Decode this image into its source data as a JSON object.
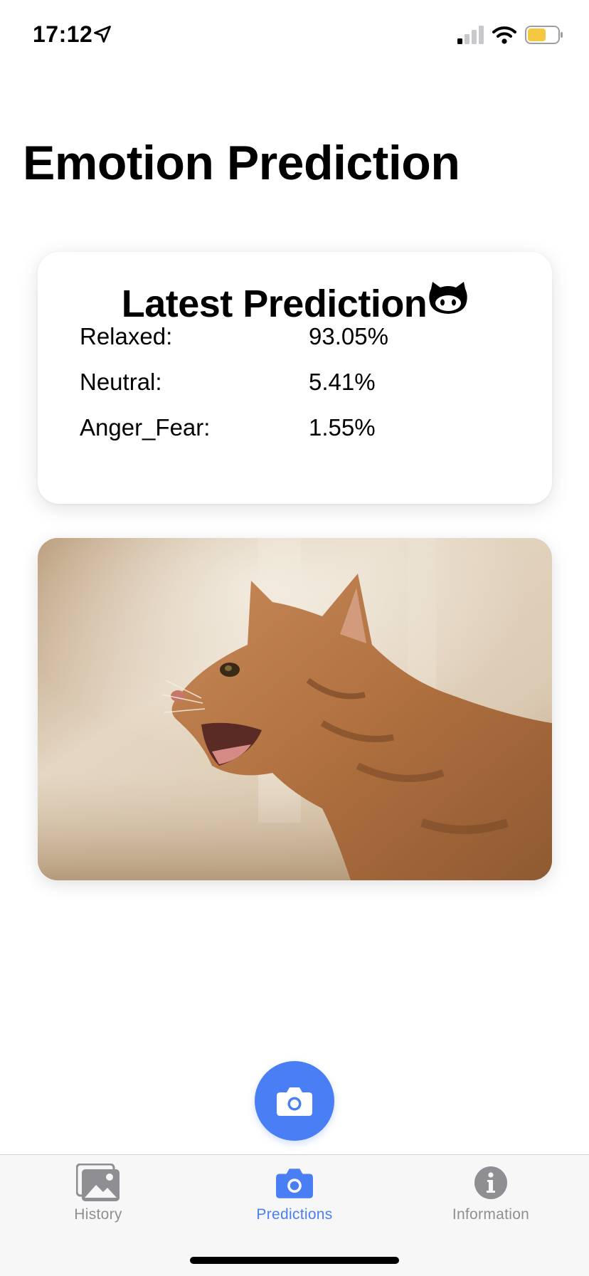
{
  "status_bar": {
    "time": "17:12",
    "icons": [
      "location-arrow-icon",
      "cellular-signal-icon",
      "wifi-icon",
      "battery-icon"
    ]
  },
  "page": {
    "title": "Emotion Prediction"
  },
  "latest_prediction": {
    "title": "Latest Prediction",
    "title_icon": "cat-face-icon",
    "rows": [
      {
        "label": "Relaxed:",
        "value": "93.05%"
      },
      {
        "label": "Neutral:",
        "value": "5.41%"
      },
      {
        "label": "Anger_Fear:",
        "value": "1.55%"
      }
    ]
  },
  "photo": {
    "subject": "cat-photo"
  },
  "fab": {
    "icon": "camera-icon"
  },
  "tabs": [
    {
      "label": "History",
      "icon": "photos-icon",
      "active": false
    },
    {
      "label": "Predictions",
      "icon": "camera-icon",
      "active": true
    },
    {
      "label": "Information",
      "icon": "info-icon",
      "active": false
    }
  ],
  "colors": {
    "accent": "#4a7ef5",
    "inactive": "#8e8e93",
    "battery": "#f5c842"
  }
}
